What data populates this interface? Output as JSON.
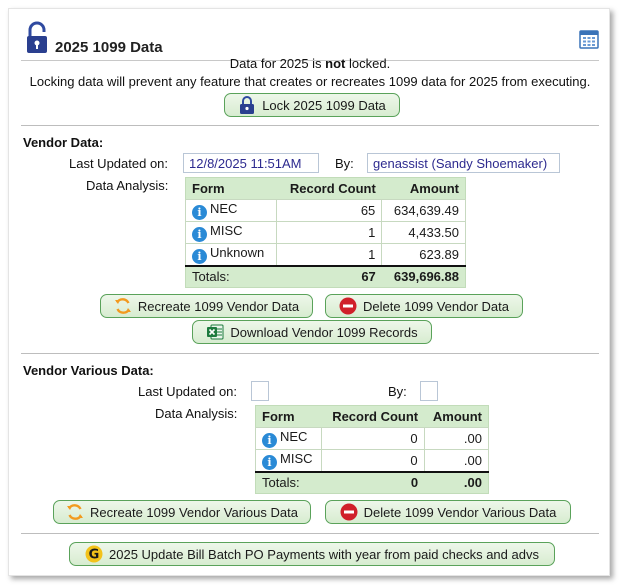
{
  "header": {
    "title": "2025 1099 Data"
  },
  "lock_status": {
    "line1_prefix": "Data for 2025 is ",
    "line1_bold": "not",
    "line1_suffix": " locked.",
    "line2": "Locking data will prevent any feature that creates or recreates 1099 data for 2025 from executing.",
    "lock_button": "Lock 2025 1099 Data"
  },
  "vendor": {
    "section_title": "Vendor Data:",
    "last_updated_label": "Last Updated on:",
    "last_updated_value": "12/8/2025 11:51AM",
    "by_label": "By:",
    "by_value": "genassist (Sandy Shoemaker)",
    "analysis_label": "Data Analysis:",
    "table": {
      "headers": [
        "Form",
        "Record Count",
        "Amount"
      ],
      "rows": [
        {
          "form": "NEC",
          "count": "65",
          "amount": "634,639.49"
        },
        {
          "form": "MISC",
          "count": "1",
          "amount": "4,433.50"
        },
        {
          "form": "Unknown",
          "count": "1",
          "amount": "623.89"
        }
      ],
      "totals": {
        "label": "Totals:",
        "count": "67",
        "amount": "639,696.88"
      }
    },
    "recreate_button": "Recreate 1099 Vendor Data",
    "delete_button": "Delete 1099 Vendor Data",
    "download_button": "Download Vendor 1099 Records"
  },
  "various": {
    "section_title": "Vendor Various Data:",
    "last_updated_label": "Last Updated on:",
    "last_updated_value": "",
    "by_label": "By:",
    "by_value": "",
    "analysis_label": "Data Analysis:",
    "table": {
      "headers": [
        "Form",
        "Record Count",
        "Amount"
      ],
      "rows": [
        {
          "form": "NEC",
          "count": "0",
          "amount": ".00"
        },
        {
          "form": "MISC",
          "count": "0",
          "amount": ".00"
        }
      ],
      "totals": {
        "label": "Totals:",
        "count": "0",
        "amount": ".00"
      }
    },
    "recreate_button": "Recreate 1099 Vendor Various Data",
    "delete_button": "Delete 1099 Vendor Various Data"
  },
  "footer_button": "2025 Update Bill Batch PO Payments with year from paid checks and advs",
  "colors": {
    "button_bg": "#d7ecd0",
    "button_border": "#5aa25a",
    "table_header": "#d4ebcd",
    "link_text": "#2d2a8f",
    "info_icon": "#2a8ad6",
    "delete_icon": "#d0202a"
  }
}
